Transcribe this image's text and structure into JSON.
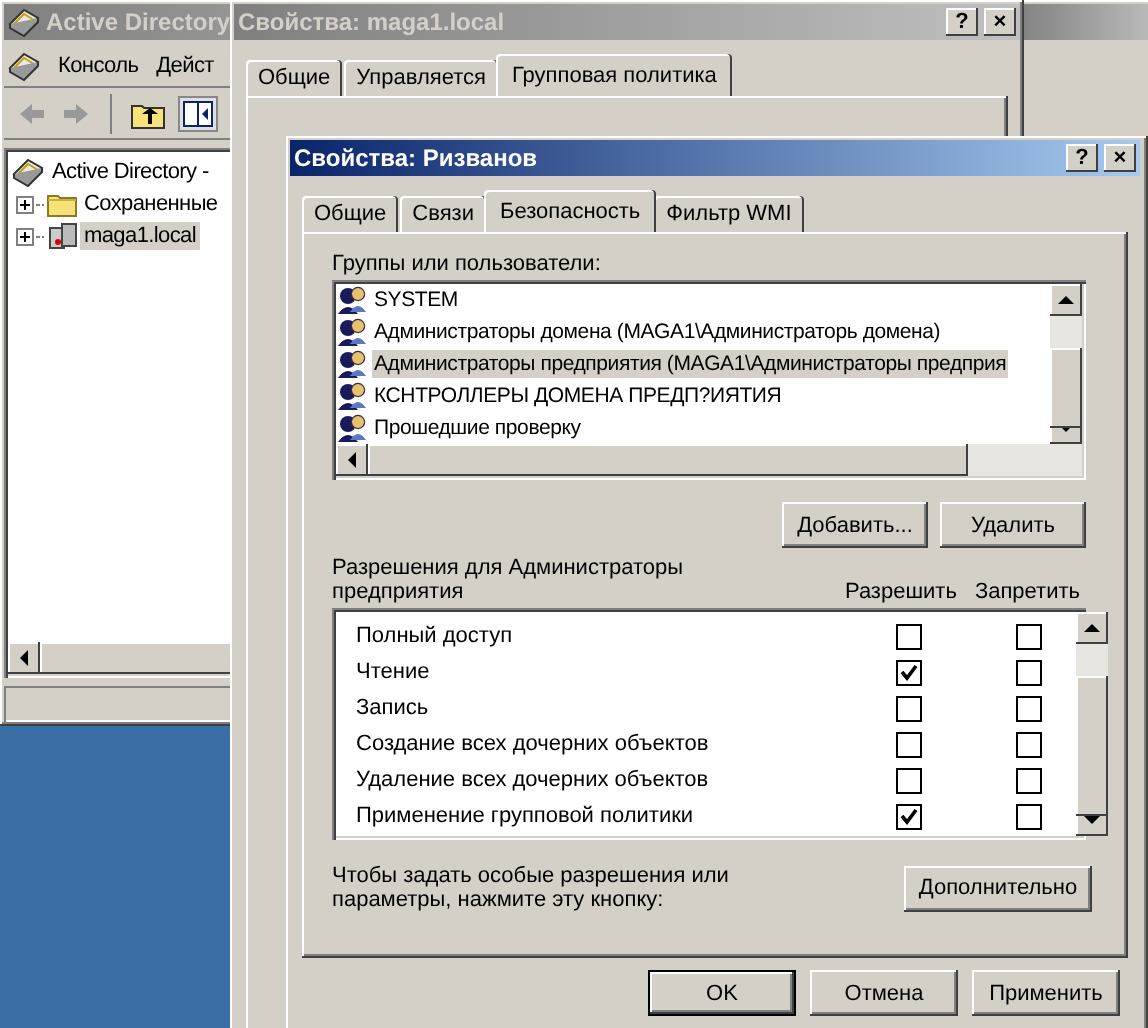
{
  "background_window": {
    "active": false
  },
  "console_window": {
    "title": "Active Directory",
    "active": false,
    "menu": [
      "Консоль",
      "Дейст"
    ],
    "tree": [
      {
        "label": "Active Directory -",
        "selected": false,
        "children": [
          {
            "label": "Сохраненные",
            "selected": false,
            "expanded": false,
            "kind": "folder"
          },
          {
            "label": "maga1.local",
            "selected": true,
            "expanded": false,
            "kind": "domain"
          }
        ]
      }
    ]
  },
  "domain_properties": {
    "title": "Свойства: maga1.local",
    "active": false,
    "title_buttons": [
      "?",
      "×"
    ],
    "tabs": [
      {
        "label": "Общие",
        "selected": false
      },
      {
        "label": "Управляется",
        "selected": false
      },
      {
        "label": "Групповая политика",
        "selected": true
      }
    ]
  },
  "user_properties": {
    "title": "Свойства: Ризванов",
    "active": true,
    "title_buttons": [
      "?",
      "×"
    ],
    "tabs": [
      {
        "label": "Общие",
        "selected": false
      },
      {
        "label": "Связи",
        "selected": false
      },
      {
        "label": "Безопасность",
        "selected": true
      },
      {
        "label": "Фильтр WMI",
        "selected": false
      }
    ],
    "groups_label": "Группы или пользователи:",
    "groups": [
      {
        "name": "SYSTEM",
        "selected": false
      },
      {
        "name": "Администраторы домена (MAGA1\\Администраторь домена)",
        "selected": false
      },
      {
        "name": "Администраторы предприятия (MAGA1\\Администраторы предприя",
        "selected": true
      },
      {
        "name": "КСНТРОЛЛЕРЫ ДОМЕНА ПРЕДП?ИЯТИЯ",
        "selected": false
      },
      {
        "name": "Прошедшие проверку",
        "selected": false
      }
    ],
    "group_buttons": [
      "Добавить...",
      "Удалить"
    ],
    "permissions_label": "Разрешения для Администраторы предприятия",
    "permission_columns": [
      "Разрешить",
      "Запретить"
    ],
    "permissions": [
      {
        "name": "Полный доступ",
        "allow": false,
        "deny": false
      },
      {
        "name": "Чтение",
        "allow": true,
        "deny": false
      },
      {
        "name": "Запись",
        "allow": false,
        "deny": false
      },
      {
        "name": "Создание всех дочерних объектов",
        "allow": false,
        "deny": false
      },
      {
        "name": "Удаление всех дочерних объектов",
        "allow": false,
        "deny": false
      },
      {
        "name": "Применение групповой политики",
        "allow": true,
        "deny": false
      }
    ],
    "advanced_note": "Чтобы задать особые разрешения или параметры, нажмите эту кнопку:",
    "advanced_button": "Дополнительно",
    "dialog_buttons": [
      "OK",
      "Отмена",
      "Применить"
    ]
  }
}
